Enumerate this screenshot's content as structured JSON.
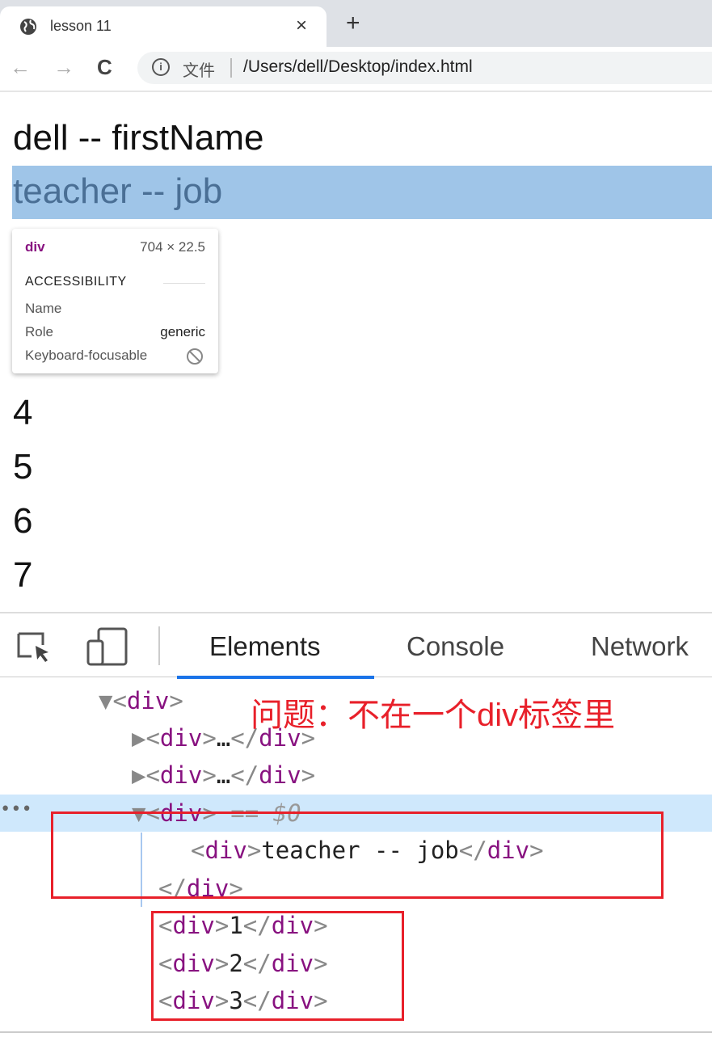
{
  "browser": {
    "tab_title": "lesson 11",
    "close_glyph": "×",
    "new_tab_glyph": "+",
    "back_glyph": "←",
    "forward_glyph": "→",
    "reload_glyph": "C",
    "info_glyph": "i",
    "file_label": "文件",
    "url": "/Users/dell/Desktop/index.html"
  },
  "page": {
    "lines": [
      "dell -- firstName",
      "teacher -- job",
      "4",
      "5",
      "6",
      "7"
    ],
    "highlight_color": "#9fc5e8"
  },
  "tooltip": {
    "tag": "div",
    "size": "704 × 22.5",
    "section": "ACCESSIBILITY",
    "name_label": "Name",
    "role_label": "Role",
    "role_value": "generic",
    "focus_label": "Keyboard-focusable"
  },
  "devtools": {
    "tabs": [
      "Elements",
      "Console",
      "Network"
    ],
    "active_tab": "Elements",
    "dom": {
      "l1": "div",
      "l2": "div",
      "l3": "div",
      "l4": "div",
      "l4_suffix": " == $0",
      "l5_text": "teacher -- job",
      "l6": "div",
      "rows": [
        "1",
        "2",
        "3"
      ],
      "ellipsis": "…",
      "dots": "•••"
    }
  },
  "annotation": {
    "text": "问题：不在一个div标签里",
    "color": "#e8202a"
  }
}
